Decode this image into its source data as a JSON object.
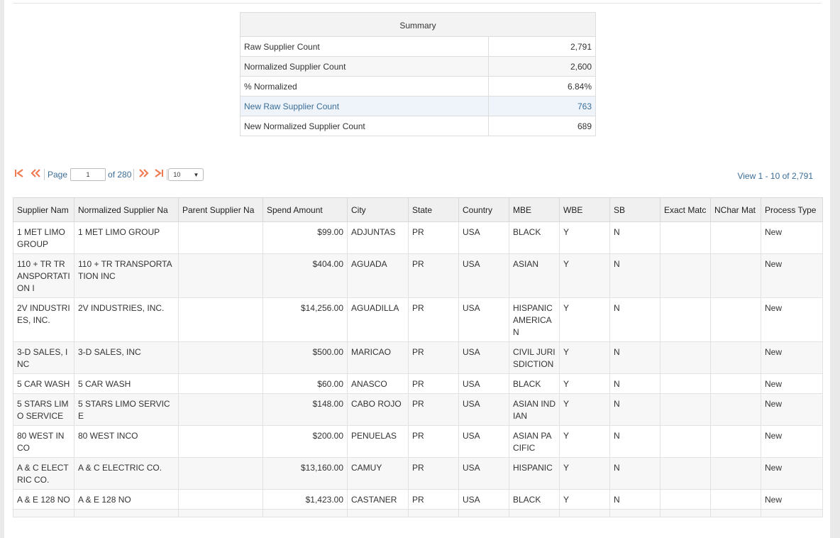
{
  "summary": {
    "title": "Summary",
    "rows": [
      {
        "label": "Raw Supplier Count",
        "value": "2,791"
      },
      {
        "label": "Normalized Supplier Count",
        "value": "2,600"
      },
      {
        "label": "% Normalized",
        "value": "6.84%"
      },
      {
        "label": "New Raw Supplier Count",
        "value": "763"
      },
      {
        "label": "New Normalized Supplier Count",
        "value": "689"
      }
    ]
  },
  "pager": {
    "first_icon": "first-page-icon",
    "prev_icon": "prev-page-icon",
    "next_icon": "next-page-icon",
    "last_icon": "last-page-icon",
    "page_label": "Page",
    "page_value": "1",
    "of_label": "of 280",
    "page_size": "10",
    "view_info": "View 1 - 10 of 2,791"
  },
  "grid": {
    "columns": [
      "Supplier Nam",
      "Normalized Supplier Na",
      "Parent Supplier Na",
      "Spend Amount",
      "City",
      "State",
      "Country",
      "MBE",
      "WBE",
      "SB",
      "Exact Matc",
      "NChar Mat",
      "Process Type"
    ],
    "rows": [
      [
        "1 MET LIMO GROUP",
        "1 MET LIMO GROUP",
        "",
        "$99.00",
        "ADJUNTAS",
        "PR",
        "USA",
        "BLACK",
        "Y",
        "N",
        "",
        "",
        "New"
      ],
      [
        "110 + TR TRANSPORTATION I",
        "110 + TR TRANSPORTATION INC",
        "",
        "$404.00",
        "AGUADA",
        "PR",
        "USA",
        "ASIAN",
        "Y",
        "N",
        "",
        "",
        "New"
      ],
      [
        "2V INDUSTRIES, INC.",
        "2V INDUSTRIES, INC.",
        "",
        "$14,256.00",
        "AGUADILLA",
        "PR",
        "USA",
        "HISPANIC AMERICAN",
        "Y",
        "N",
        "",
        "",
        "New"
      ],
      [
        "3-D SALES, INC",
        "3-D SALES, INC",
        "",
        "$500.00",
        "MARICAO",
        "PR",
        "USA",
        "CIVIL JURISDICTION",
        "Y",
        "N",
        "",
        "",
        "New"
      ],
      [
        "5 CAR WASH",
        "5 CAR WASH",
        "",
        "$60.00",
        "ANASCO",
        "PR",
        "USA",
        "BLACK",
        "Y",
        "N",
        "",
        "",
        "New"
      ],
      [
        "5 STARS LIMO SERVICE",
        "5 STARS LIMO SERVICE",
        "",
        "$148.00",
        "CABO ROJO",
        "PR",
        "USA",
        "ASIAN INDIAN",
        "Y",
        "N",
        "",
        "",
        "New"
      ],
      [
        "80 WEST INCO",
        "80 WEST INCO",
        "",
        "$200.00",
        "PENUELAS",
        "PR",
        "USA",
        "ASIAN PACIFIC",
        "Y",
        "N",
        "",
        "",
        "New"
      ],
      [
        "A & C ELECTRIC CO.",
        "A & C ELECTRIC CO.",
        "",
        "$13,160.00",
        "CAMUY",
        "PR",
        "USA",
        "HISPANIC",
        "Y",
        "N",
        "",
        "",
        "New"
      ],
      [
        "A & E 128 NO",
        "A & E 128 NO",
        "",
        "$1,423.00",
        "CASTANER",
        "PR",
        "USA",
        "BLACK",
        "Y",
        "N",
        "",
        "",
        "New"
      ],
      [
        "",
        "",
        "",
        "",
        "",
        "",
        "",
        "",
        "",
        "",
        "",
        "",
        ""
      ]
    ]
  }
}
